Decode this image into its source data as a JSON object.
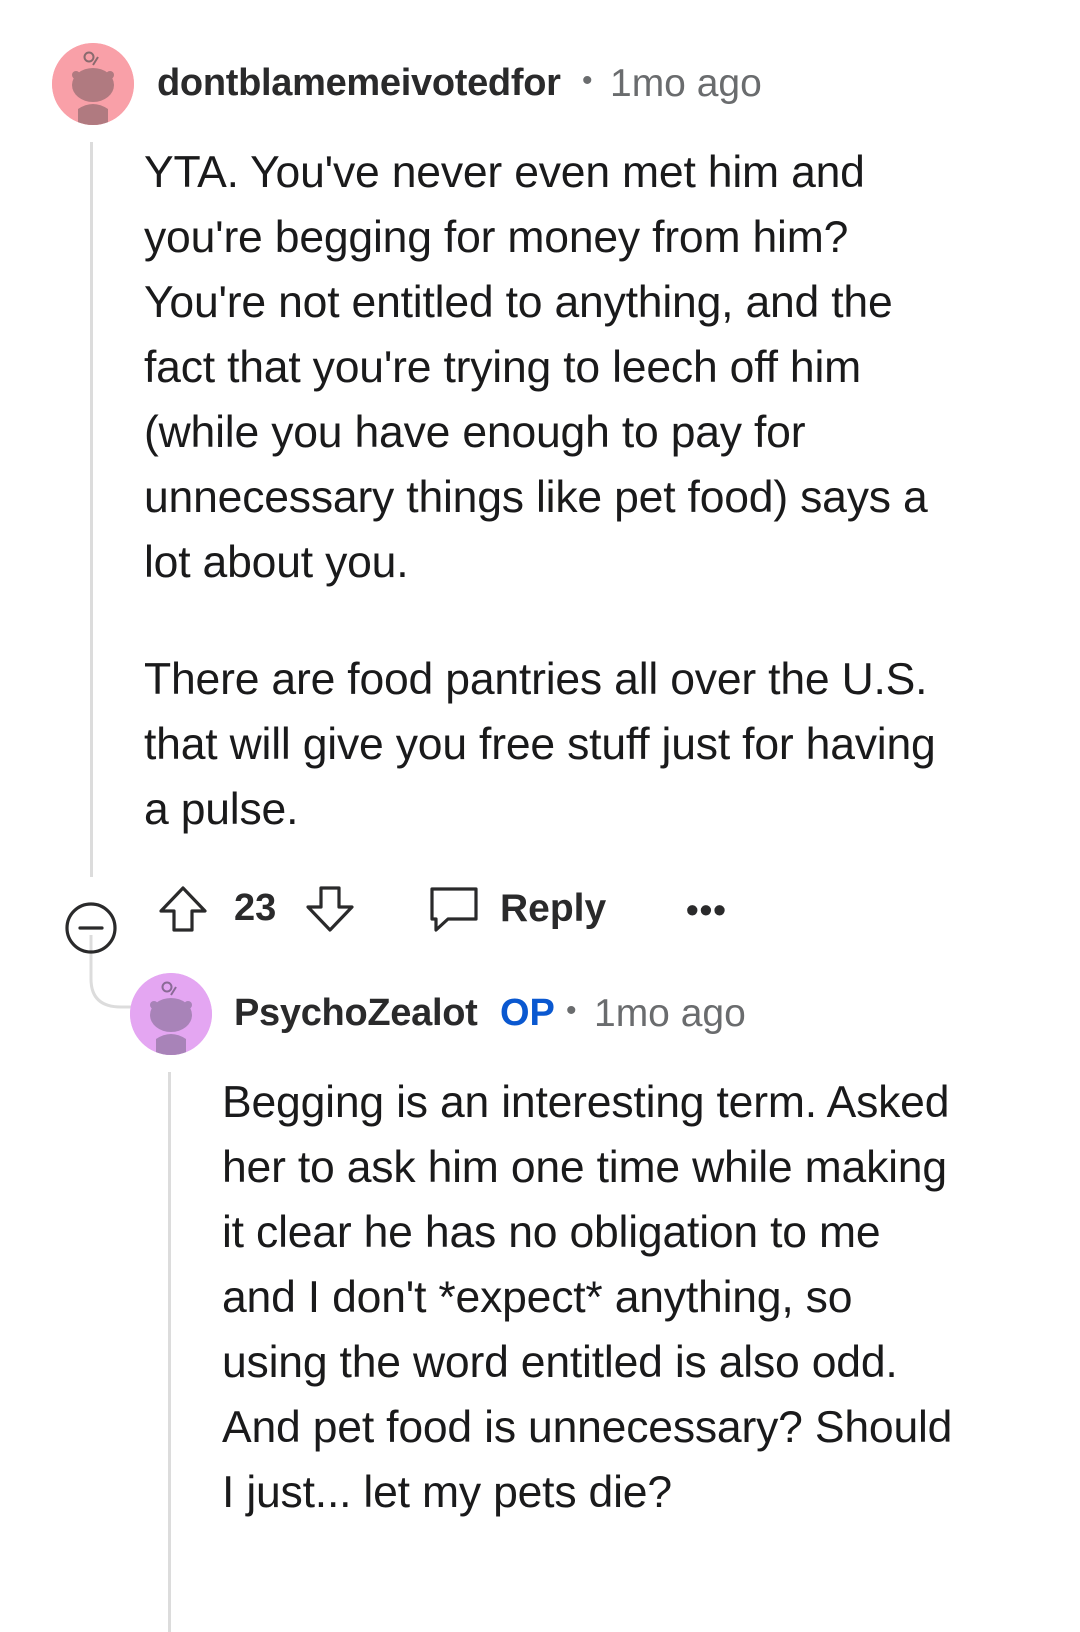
{
  "comment": {
    "username": "dontblamemeivotedfor",
    "separator": "•",
    "time": "1mo ago",
    "avatar_color": "#f9a0a8",
    "body": [
      "YTA. You've never even met him and\nyou're begging for money from him?\nYou're not entitled to anything, and the\nfact that you're trying to leech off him\n(while you have enough to pay for\nunnecessary things like pet food) says a\nlot about you.",
      "There are food pantries all over the U.S.\nthat will give you free stuff just for having\na pulse."
    ],
    "actions": {
      "collapse_icon": "minus-circle-icon",
      "upvote_icon": "arrow-up-icon",
      "vote_count": "23",
      "downvote_icon": "arrow-down-icon",
      "reply_icon": "speech-bubble-icon",
      "reply_label": "Reply",
      "more_label": "•••"
    }
  },
  "reply": {
    "username": "PsychoZealot",
    "op_badge": "OP",
    "separator": "•",
    "time": "1mo ago",
    "avatar_color": "#e4a6f2",
    "body": "Begging is an interesting term. Asked\nher to ask him one time while making\nit clear he has no obligation to me\nand I don't *expect* anything, so\nusing the word entitled is also odd.\nAnd pet food is unnecessary? Should\nI just... let my pets die?"
  },
  "colors": {
    "accent_op": "#0a58d0",
    "meta_gray": "#6a6c6e",
    "thread_line": "#dcdcdc"
  }
}
